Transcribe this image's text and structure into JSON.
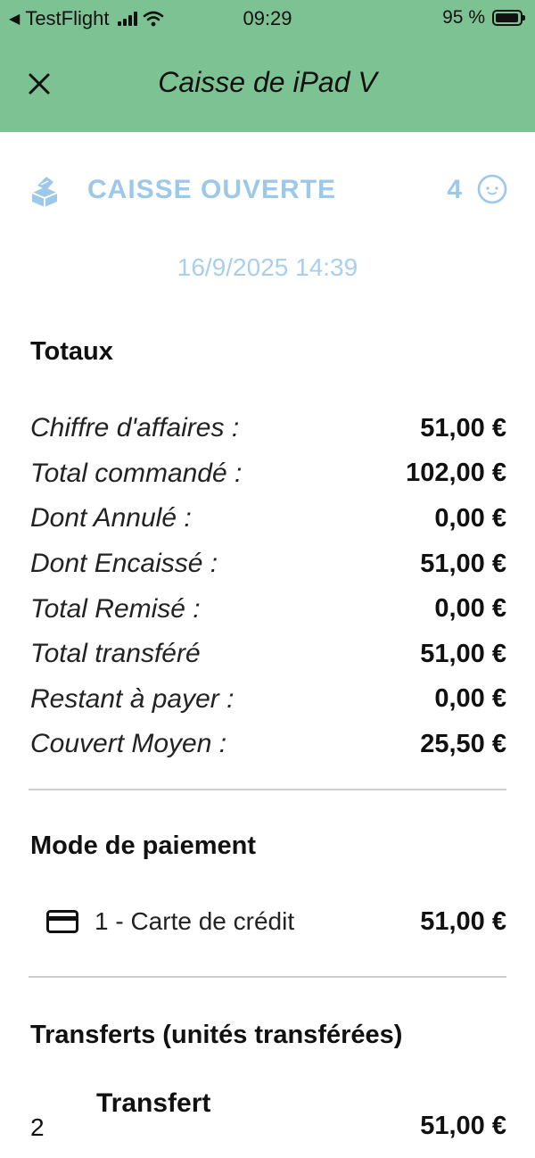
{
  "status_bar": {
    "app_back": "TestFlight",
    "time": "09:29",
    "battery": "95 %",
    "battery_level": 0.95
  },
  "header": {
    "title": "Caisse de iPad V",
    "close_icon": "close-icon",
    "background": "#7dc293"
  },
  "register": {
    "status": "CAISSE OUVERTE",
    "guests": "4",
    "opened_at": "16/9/2025 14:39",
    "accent": "#9cc8ea"
  },
  "totals": {
    "title": "Totaux",
    "rows": [
      {
        "label": "Chiffre d'affaires :",
        "value": "51,00 €"
      },
      {
        "label": "Total commandé :",
        "value": "102,00 €"
      },
      {
        "label": "Dont Annulé :",
        "value": "0,00 €"
      },
      {
        "label": "Dont Encaissé :",
        "value": "51,00 €"
      },
      {
        "label": "Total Remisé :",
        "value": "0,00 €"
      },
      {
        "label": "Total transféré",
        "value": "51,00 €"
      },
      {
        "label": "Restant à payer :",
        "value": "0,00 €"
      },
      {
        "label": "Couvert Moyen :",
        "value": "25,50 €"
      }
    ]
  },
  "payment": {
    "title": "Mode de paiement",
    "items": [
      {
        "icon": "credit-card-icon",
        "label": "1 - Carte de crédit",
        "value": "51,00 €"
      }
    ]
  },
  "transfers": {
    "title": "Transferts (unités transférées)",
    "items": [
      {
        "prefix": "2",
        "label": "Transfert",
        "value": "51,00 €"
      }
    ]
  }
}
